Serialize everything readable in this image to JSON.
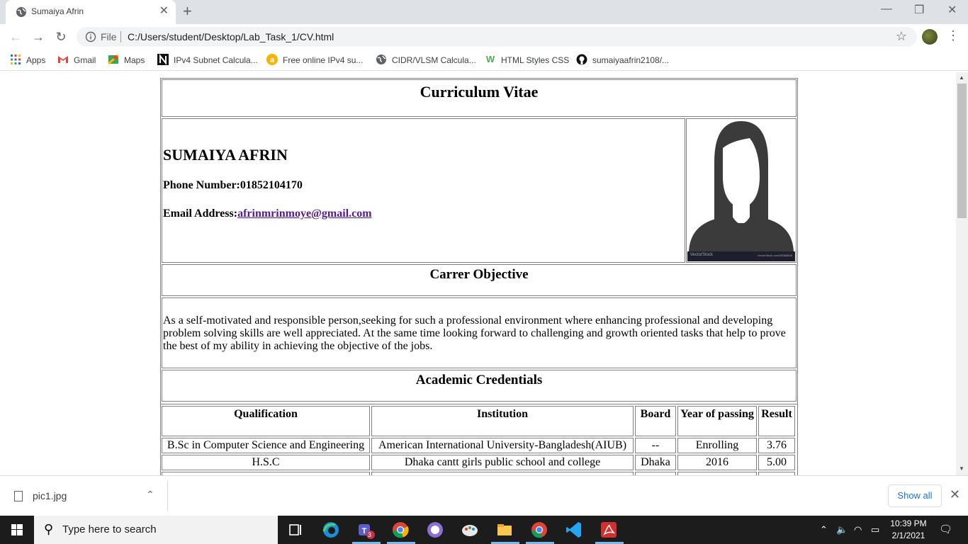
{
  "browser": {
    "tab_title": "Sumaiya Afrin",
    "url_scheme": "File",
    "url": "C:/Users/student/Desktop/Lab_Task_1/CV.html",
    "bookmarks": [
      {
        "label": "Apps",
        "icon": "apps-grid-icon"
      },
      {
        "label": "Gmail",
        "icon": "gmail-icon"
      },
      {
        "label": "Maps",
        "icon": "maps-icon"
      },
      {
        "label": "IPv4 Subnet Calcula...",
        "icon": "n-logo-icon"
      },
      {
        "label": "Free online IPv4 su...",
        "icon": "a-logo-icon"
      },
      {
        "label": "CIDR/VLSM Calcula...",
        "icon": "globe-icon"
      },
      {
        "label": "HTML Styles CSS",
        "icon": "w3schools-icon"
      },
      {
        "label": "sumaiyaafrin2108/...",
        "icon": "github-icon"
      }
    ]
  },
  "cv": {
    "title": "Curriculum Vitae",
    "name": "SUMAIYA AFRIN",
    "phone_label": "Phone Number:",
    "phone": "01852104170",
    "email_label": "Email Address:",
    "email": "afrinmrinmoye@gmail.com",
    "photo_watermark_left": "VectorStock",
    "photo_watermark_right": "VectorStock.com/28368808",
    "objective_title": "Carrer Objective",
    "objective_text": "As a self-motivated and responsible person,seeking for such a professional environment where enhancing professional and developing problem solving skills are well appreciated. At the same time looking forward to challenging and growth oriented tasks that help to prove the best of my ability in achieving the objective of the jobs.",
    "academic_title": "Academic Credentials",
    "table": {
      "headers": [
        "Qualification",
        "Institution",
        "Board",
        "Year of passing",
        "Result"
      ],
      "rows": [
        [
          "B.Sc in Computer Science and Engineering",
          "American International University-Bangladesh(AIUB)",
          "--",
          "Enrolling",
          "3.76"
        ],
        [
          "H.S.C",
          "Dhaka cantt girls public school and college",
          "Dhaka",
          "2016",
          "5.00"
        ]
      ]
    }
  },
  "download_bar": {
    "file": "pic1.jpg",
    "show_all": "Show all"
  },
  "taskbar": {
    "search_placeholder": "Type here to search",
    "teams_badge": "3",
    "time": "10:39 PM",
    "date": "2/1/2021"
  }
}
